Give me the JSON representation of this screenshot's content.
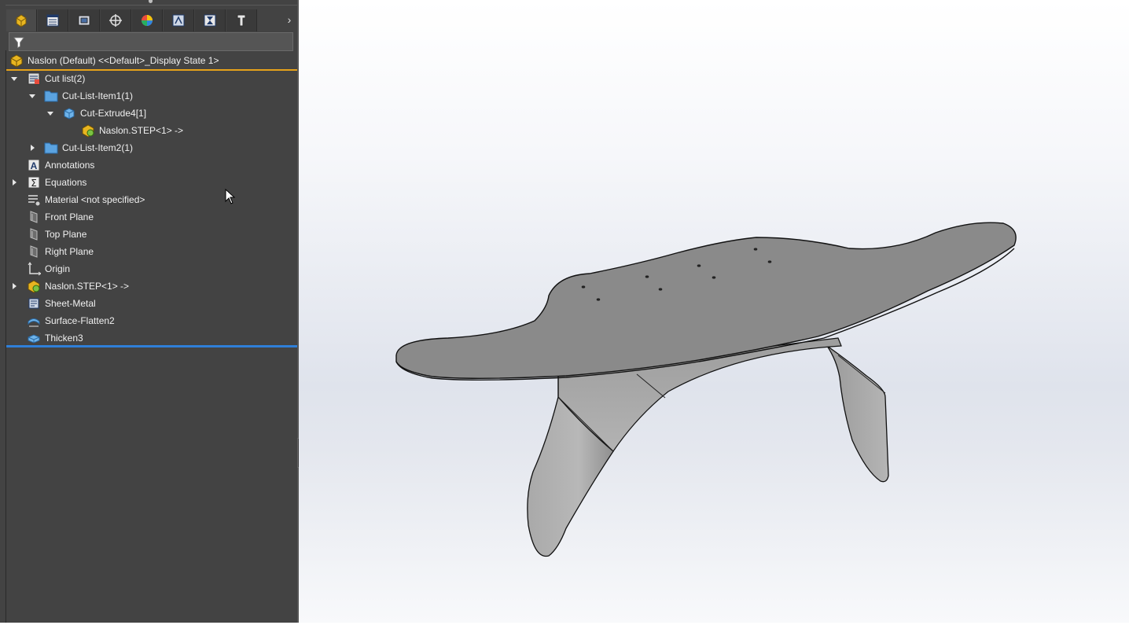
{
  "tabs": [
    {
      "icon": "part-icon",
      "active": true
    },
    {
      "icon": "property-manager-icon",
      "active": false
    },
    {
      "icon": "configuration-manager-icon",
      "active": false
    },
    {
      "icon": "dimxpert-icon",
      "active": false
    },
    {
      "icon": "display-manager-icon",
      "active": false
    },
    {
      "icon": "cam-icon",
      "active": false
    },
    {
      "icon": "hole-wizard-icon",
      "active": false
    },
    {
      "icon": "tolerance-icon",
      "active": false
    }
  ],
  "tab_more_glyph": "›",
  "filter": {
    "placeholder": ""
  },
  "root": {
    "label": "Naslon (Default) <<Default>_Display State 1>"
  },
  "tree": [
    {
      "label": "Cut list(2)",
      "icon": "cut-list-icon",
      "expand": "open"
    },
    {
      "label": "Cut-List-Item1(1)",
      "icon": "folder-icon",
      "expand": "open"
    },
    {
      "label": "Cut-Extrude4[1]",
      "icon": "solid-body-icon",
      "expand": "open"
    },
    {
      "label": "Naslon.STEP<1> ->",
      "icon": "imported-part-icon",
      "expand": "none"
    },
    {
      "label": "Cut-List-Item2(1)",
      "icon": "folder-icon",
      "expand": "closed"
    },
    {
      "label": "Annotations",
      "icon": "annotations-icon",
      "expand": "none"
    },
    {
      "label": "Equations",
      "icon": "equations-icon",
      "expand": "closed"
    },
    {
      "label": "Material <not specified>",
      "icon": "material-icon",
      "expand": "none"
    },
    {
      "label": "Front Plane",
      "icon": "plane-icon",
      "expand": "none"
    },
    {
      "label": "Top Plane",
      "icon": "plane-icon",
      "expand": "none"
    },
    {
      "label": "Right Plane",
      "icon": "plane-icon",
      "expand": "none"
    },
    {
      "label": "Origin",
      "icon": "origin-icon",
      "expand": "none"
    },
    {
      "label": "Naslon.STEP<1> ->",
      "icon": "imported-part-icon",
      "expand": "closed"
    },
    {
      "label": "Sheet-Metal",
      "icon": "sheet-metal-icon",
      "expand": "none"
    },
    {
      "label": "Surface-Flatten2",
      "icon": "surface-flatten-icon",
      "expand": "none"
    },
    {
      "label": "Thicken3",
      "icon": "thicken-icon",
      "expand": "none"
    }
  ],
  "colors": {
    "panel_bg": "#434343",
    "root_underline": "#e6a21a",
    "rollback_bar": "#2f7fd8",
    "model_fill": "#8a8a8a"
  }
}
